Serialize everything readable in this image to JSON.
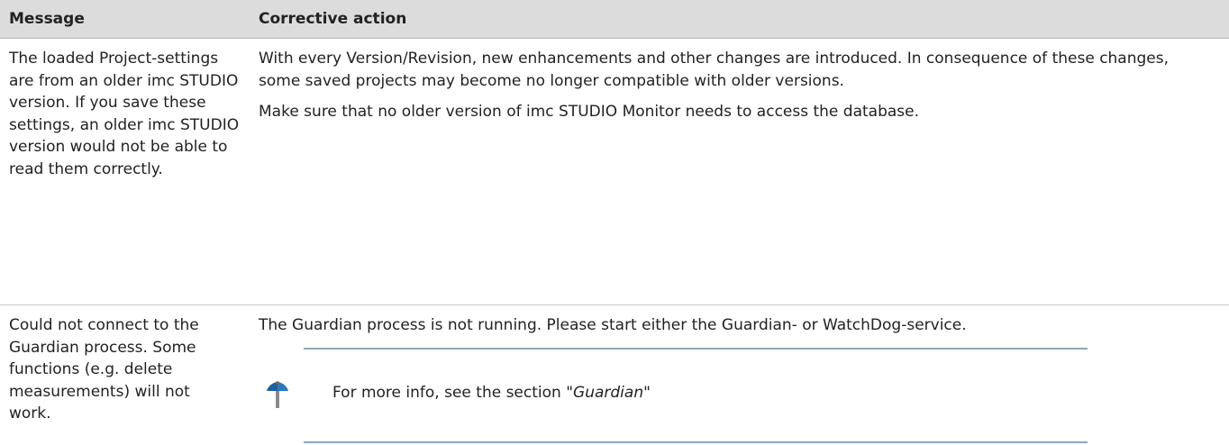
{
  "table": {
    "headers": {
      "message": "Message",
      "corrective_action": "Corrective action"
    },
    "rows": [
      {
        "message": "The loaded Project-settings are from an older imc STUDIO version. If you save these settings, an older imc STUDIO version would not be able to read them correctly.",
        "action_paragraphs": [
          "With every Version/Revision, new enhancements and other changes are introduced. In consequence of these changes, some saved projects may become no longer compatible with older versions.",
          "Make sure that no older version of imc STUDIO Monitor needs to access the database."
        ]
      },
      {
        "message": "Could not connect to the Guardian process. Some functions (e.g. delete measurements) will not work.",
        "action_paragraphs": [
          "The Guardian process is not running. Please start either the Guardian- or WatchDog-service."
        ],
        "note": {
          "icon": "signpost-icon",
          "prefix": "For more info, see the section \"",
          "link": "Guardian",
          "suffix": "\""
        }
      }
    ]
  },
  "colors": {
    "header_bg": "#dcdcdc",
    "rule": "#8aa9b3",
    "icon_blue": "#1f5f9f",
    "icon_gray": "#8a8a8a"
  }
}
